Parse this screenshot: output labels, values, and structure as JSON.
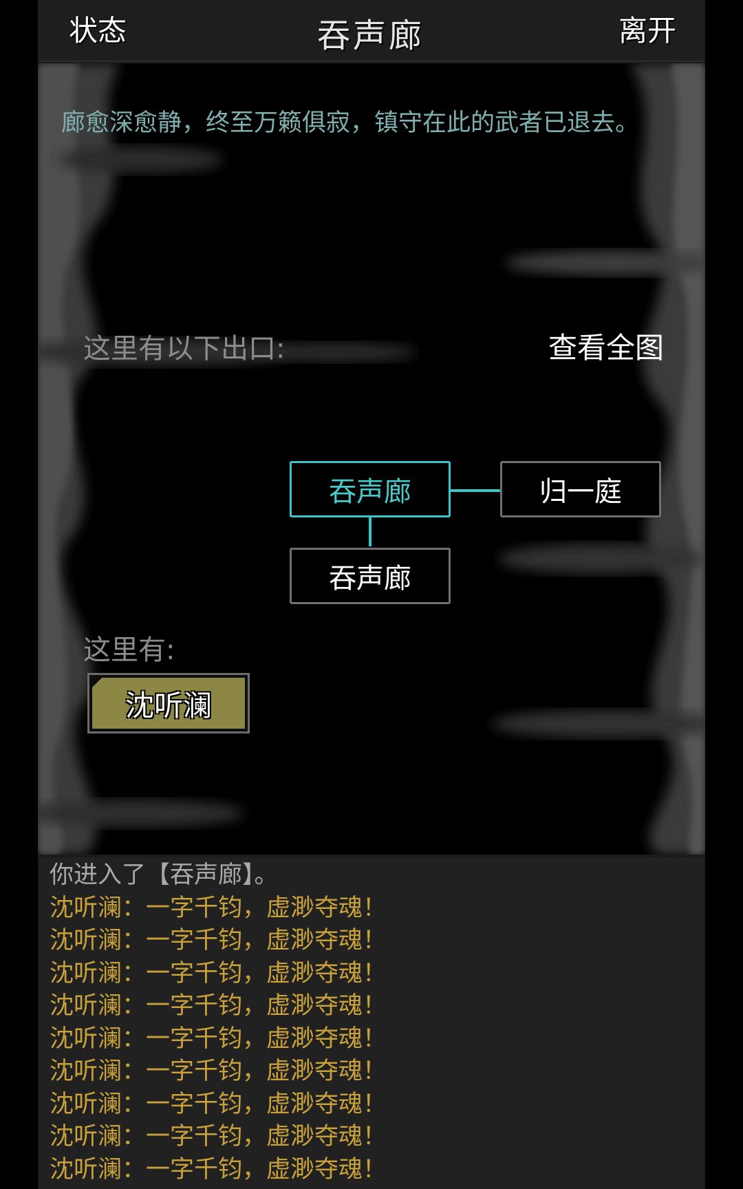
{
  "header": {
    "left_button": "状态",
    "title": "吞声廊",
    "right_button": "离开"
  },
  "scene": {
    "description": "廊愈深愈静，终至万籁俱寂，镇守在此的武者已退去。",
    "exits_label": "这里有以下出口:",
    "fullmap_label": "查看全图",
    "rooms": {
      "current": "吞声廊",
      "east": "归一庭",
      "south": "吞声廊"
    },
    "here_label": "这里有:",
    "npc_name": "沈听澜"
  },
  "colors": {
    "current_room": "#37c6c9",
    "npc_button": "#8c8745",
    "dialogue": "#c8a13a",
    "description": "#7fb0b0"
  },
  "log": [
    {
      "type": "sys",
      "text": "你进入了【吞声廊】。"
    },
    {
      "type": "say",
      "text": "沈听澜：一字千钧，虚渺夺魂！"
    },
    {
      "type": "say",
      "text": "沈听澜：一字千钧，虚渺夺魂！"
    },
    {
      "type": "say",
      "text": "沈听澜：一字千钧，虚渺夺魂！"
    },
    {
      "type": "say",
      "text": "沈听澜：一字千钧，虚渺夺魂！"
    },
    {
      "type": "say",
      "text": "沈听澜：一字千钧，虚渺夺魂！"
    },
    {
      "type": "say",
      "text": "沈听澜：一字千钧，虚渺夺魂！"
    },
    {
      "type": "say",
      "text": "沈听澜：一字千钧，虚渺夺魂！"
    },
    {
      "type": "say",
      "text": "沈听澜：一字千钧，虚渺夺魂！"
    },
    {
      "type": "say",
      "text": "沈听澜：一字千钧，虚渺夺魂！"
    }
  ]
}
